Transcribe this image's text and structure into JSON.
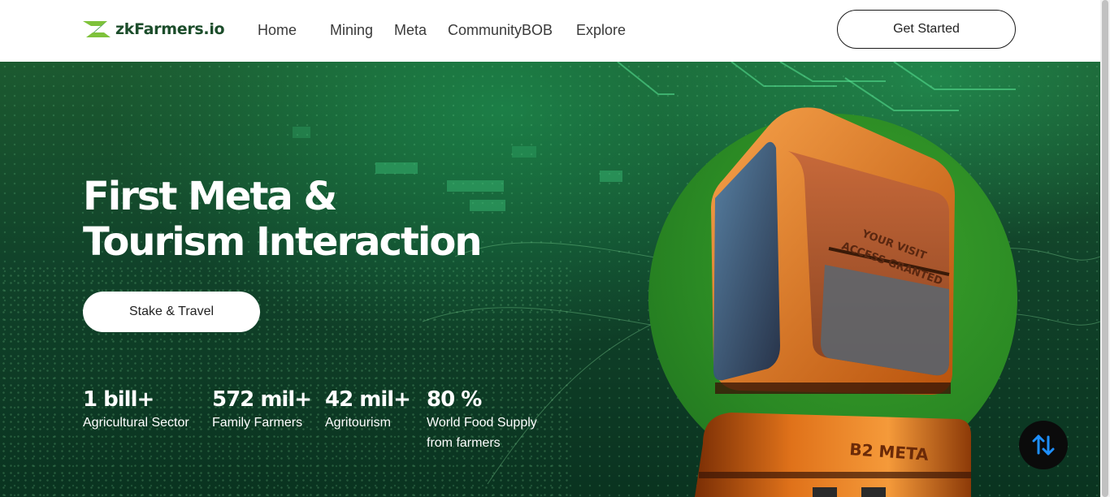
{
  "brand": {
    "name": "zkFarmers.io",
    "color": "#1c4d2b",
    "logo_icon": "zk-logo-icon"
  },
  "nav": {
    "items": [
      {
        "label": "Home"
      },
      {
        "label": "Mining"
      },
      {
        "label": "Meta"
      },
      {
        "label": "CommunityBOB"
      },
      {
        "label": "Explore"
      }
    ]
  },
  "header": {
    "cta_label": "Get Started"
  },
  "hero": {
    "title_line1": "First Meta &",
    "title_line2": "Tourism Interaction",
    "cta_label": "Stake & Travel",
    "stats": [
      {
        "value": "1 bill+",
        "label": "Agricultural Sector"
      },
      {
        "value": "572 mil+",
        "label": "Family Farmers"
      },
      {
        "value": "42 mil+",
        "label": "Agritourism"
      },
      {
        "value": "80 %",
        "label_line1": "World Food Supply",
        "label_line2": "from farmers"
      }
    ],
    "image": {
      "screen_text_line1": "YOUR VISIT",
      "screen_text_line2": "ACCESS GRANTED",
      "body_text": "B2 META"
    }
  },
  "floating": {
    "scroll_icon": "swap-vertical-icon",
    "accent": "#1e90ff"
  }
}
